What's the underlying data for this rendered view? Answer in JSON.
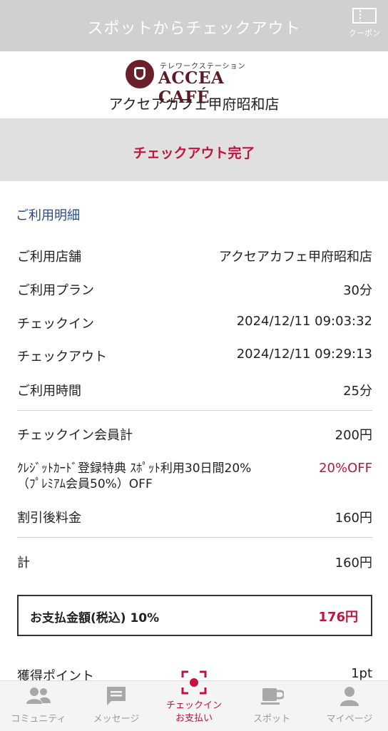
{
  "header": {
    "title": "スポットからチェックアウト",
    "coupon_label": "クーポン"
  },
  "brand": {
    "logo_sub": "テレワークステーション",
    "logo_main": "ACCEA CAFÉ",
    "store_name": "アクセアカフェ甲府昭和店"
  },
  "status": {
    "text": "チェックアウト完了"
  },
  "details": {
    "section_title": "ご利用明細",
    "rows": [
      {
        "label": "ご利用店舗",
        "value": "アクセアカフェ甲府昭和店"
      },
      {
        "label": "ご利用プラン",
        "value": "30分"
      },
      {
        "label": "チェックイン",
        "value": "2024/12/11 09:03:32"
      },
      {
        "label": "チェックアウト",
        "value": "2024/12/11 09:29:13"
      },
      {
        "label": "ご利用時間",
        "value": "25分"
      }
    ],
    "charges": [
      {
        "label": "チェックイン会員計",
        "value": "200円"
      },
      {
        "label": "ｸﾚｼﾞｯﾄｶｰﾄﾞ登録特典 ｽﾎﾟｯﾄ利用30日間20%（ﾌﾟﾚﾐｱﾑ会員50%）OFF",
        "value": "20%OFF"
      },
      {
        "label": "割引後料金",
        "value": "160円"
      },
      {
        "label": "計",
        "value": "160円"
      }
    ],
    "total": {
      "label": "お支払金額(税込) 10%",
      "value": "176円"
    },
    "points": {
      "label": "獲得ポイント",
      "value": "1pt"
    }
  },
  "tabs": [
    {
      "label": "コミュニティ",
      "icon": "community-icon"
    },
    {
      "label": "メッセージ",
      "icon": "message-icon"
    },
    {
      "label": "チェックイン\nお支払い",
      "icon": "scan-icon",
      "active": true
    },
    {
      "label": "スポット",
      "icon": "coffee-icon"
    },
    {
      "label": "マイページ",
      "icon": "person-icon"
    }
  ],
  "colors": {
    "accent": "#c0143c",
    "link": "#2b4a8a",
    "header_bg": "#d0d0d0"
  }
}
